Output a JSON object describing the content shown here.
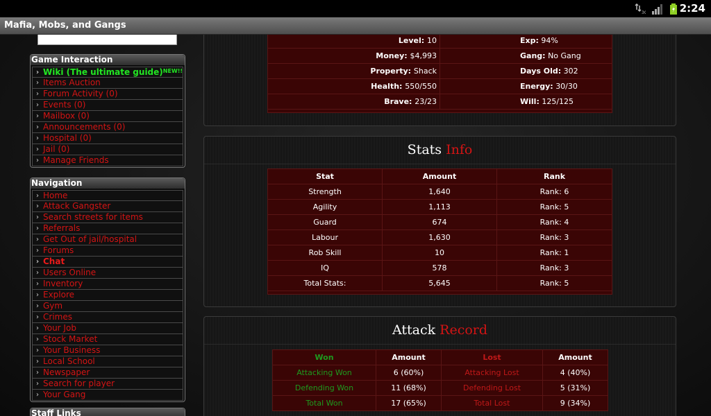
{
  "status": {
    "time": "2:24"
  },
  "app": {
    "title": "Mafia, Mobs, and Gangs"
  },
  "game_interaction": {
    "heading": "Game Interaction",
    "items": [
      {
        "label": "Wiki (The ultimate guide)",
        "badge": "NEW!!"
      },
      {
        "label": "Items Auction"
      },
      {
        "label": "Forum Activity (0)"
      },
      {
        "label": "Events (0)"
      },
      {
        "label": "Mailbox (0)"
      },
      {
        "label": "Announcements (0)"
      },
      {
        "label": "Hospital (0)"
      },
      {
        "label": "Jail (0)"
      },
      {
        "label": "Manage Friends"
      }
    ]
  },
  "navigation": {
    "heading": "Navigation",
    "items": [
      {
        "label": "Home"
      },
      {
        "label": "Attack Gangster"
      },
      {
        "label": "Search streets for items"
      },
      {
        "label": "Referrals"
      },
      {
        "label": "Get Out of jail/hospital"
      },
      {
        "label": "Forums"
      },
      {
        "label": "Chat"
      },
      {
        "label": "Users Online"
      },
      {
        "label": "Inventory"
      },
      {
        "label": "Explore"
      },
      {
        "label": "Gym"
      },
      {
        "label": "Crimes"
      },
      {
        "label": "Your Job"
      },
      {
        "label": "Stock Market"
      },
      {
        "label": "Your Business"
      },
      {
        "label": "Local School"
      },
      {
        "label": "Newspaper"
      },
      {
        "label": "Search for player"
      },
      {
        "label": "Your Gang"
      }
    ]
  },
  "staff_links": {
    "heading": "Staff Links"
  },
  "general_info": {
    "rows": [
      {
        "l_label": "Level:",
        "l_value": "10",
        "r_label": "Exp:",
        "r_value": "94%"
      },
      {
        "l_label": "Money:",
        "l_value": "$4,993",
        "r_label": "Gang:",
        "r_value": "No Gang"
      },
      {
        "l_label": "Property:",
        "l_value": "Shack",
        "r_label": "Days Old:",
        "r_value": "302"
      },
      {
        "l_label": "Health:",
        "l_value": "550/550",
        "r_label": "Energy:",
        "r_value": "30/30"
      },
      {
        "l_label": "Brave:",
        "l_value": "23/23",
        "r_label": "Will:",
        "r_value": "125/125"
      }
    ]
  },
  "stats_info": {
    "title_a": "Stats",
    "title_b": "Info",
    "headers": [
      "Stat",
      "Amount",
      "Rank"
    ],
    "rows": [
      [
        "Strength",
        "1,640",
        "Rank: 6"
      ],
      [
        "Agility",
        "1,113",
        "Rank: 5"
      ],
      [
        "Guard",
        "674",
        "Rank: 4"
      ],
      [
        "Labour",
        "1,630",
        "Rank: 3"
      ],
      [
        "Rob Skill",
        "10",
        "Rank: 1"
      ],
      [
        "IQ",
        "578",
        "Rank: 3"
      ],
      [
        "Total Stats:",
        "5,645",
        "Rank: 5"
      ]
    ]
  },
  "attack_record": {
    "title_a": "Attack",
    "title_b": "Record",
    "headers": [
      "Won",
      "Amount",
      "Lost",
      "Amount"
    ],
    "rows": [
      [
        "Attacking Won",
        "6 (60%)",
        "Attacking Lost",
        "4 (40%)"
      ],
      [
        "Defending Won",
        "11 (68%)",
        "Defending Lost",
        "5 (31%)"
      ],
      [
        "Total Won",
        "17 (65%)",
        "Total Lost",
        "9 (34%)"
      ]
    ]
  }
}
